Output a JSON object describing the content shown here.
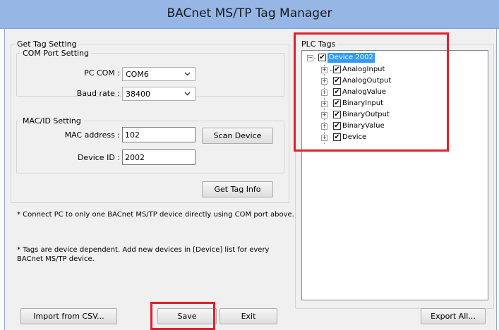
{
  "window": {
    "title": "BACnet MS/TP Tag Manager"
  },
  "get_tag_setting": {
    "legend": "Get Tag Setting",
    "com_port": {
      "legend": "COM Port Setting",
      "pc_com_label": "PC COM :",
      "pc_com_value": "COM6",
      "baud_label": "Baud rate :",
      "baud_value": "38400"
    },
    "mac_id": {
      "legend": "MAC/ID Setting",
      "mac_label": "MAC address :",
      "mac_value": "102",
      "device_id_label": "Device ID :",
      "device_id_value": "2002",
      "scan_button": "Scan Device"
    },
    "get_tag_info_button": "Get Tag Info"
  },
  "notes": {
    "connect": "* Connect PC to only one BACnet MS/TP device directly using COM port above.",
    "tags": "* Tags are device dependent. Add new devices in [Device] list for every\nBACnet MS/TP device."
  },
  "plc_tags": {
    "legend": "PLC Tags",
    "root": {
      "label": "Device 2002",
      "checked": true,
      "expander": "−"
    },
    "children": [
      {
        "label": "AnalogInput",
        "expander": "+"
      },
      {
        "label": "AnalogOutput",
        "expander": "+"
      },
      {
        "label": "AnalogValue",
        "expander": "+"
      },
      {
        "label": "BinaryInput",
        "expander": "+"
      },
      {
        "label": "BinaryOutput",
        "expander": "+"
      },
      {
        "label": "BinaryValue",
        "expander": "+"
      },
      {
        "label": "Device",
        "expander": "+"
      }
    ],
    "check_glyph": "✔"
  },
  "buttons": {
    "import": "Import from CSV...",
    "save": "Save",
    "exit": "Exit",
    "export_all": "Export All..."
  },
  "colors": {
    "highlight": "#e0202a",
    "selection": "#3399ff",
    "titlebar": "#96b6e6"
  }
}
